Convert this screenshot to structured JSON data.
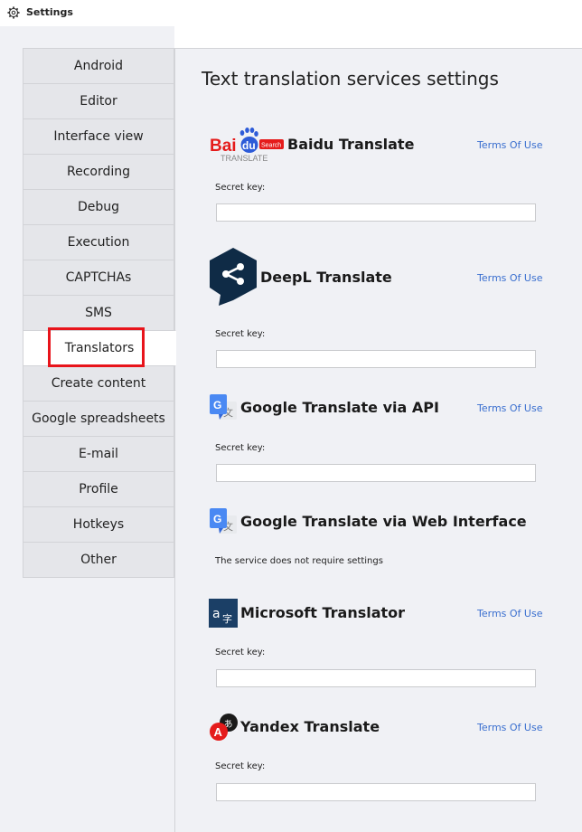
{
  "window": {
    "title": "Settings",
    "icon": "gear-icon"
  },
  "sidebar": {
    "items": [
      {
        "label": "Android"
      },
      {
        "label": "Editor"
      },
      {
        "label": "Interface view"
      },
      {
        "label": "Recording"
      },
      {
        "label": "Debug"
      },
      {
        "label": "Execution"
      },
      {
        "label": "CAPTCHAs"
      },
      {
        "label": "SMS"
      },
      {
        "label": "Translators",
        "active": true
      },
      {
        "label": "Create content"
      },
      {
        "label": "Google spreadsheets"
      },
      {
        "label": "E-mail"
      },
      {
        "label": "Profile"
      },
      {
        "label": "Hotkeys"
      },
      {
        "label": "Other"
      }
    ]
  },
  "main": {
    "title": "Text translation services settings",
    "services": {
      "baidu": {
        "name": "Baidu Translate",
        "terms": "Terms Of Use",
        "key_label": "Secret key:",
        "key_value": "",
        "logo": {
          "icon": "baidu-logo-icon",
          "text_bai": "Bai",
          "text_du": "du",
          "text_search": "Search",
          "text_translate": "TRANSLATE"
        }
      },
      "deepl": {
        "name": "DeepL Translate",
        "terms": "Terms Of Use",
        "key_label": "Secret key:",
        "key_value": "",
        "logo": {
          "icon": "deepl-logo-icon"
        }
      },
      "google_api": {
        "name": "Google Translate via API",
        "terms": "Terms Of Use",
        "key_label": "Secret key:",
        "key_value": "",
        "logo": {
          "icon": "google-translate-icon"
        }
      },
      "google_web": {
        "name": "Google Translate via Web Interface",
        "note": "The service does not require settings",
        "logo": {
          "icon": "google-translate-icon"
        }
      },
      "microsoft": {
        "name": "Microsoft Translator",
        "terms": "Terms Of Use",
        "key_label": "Secret key:",
        "key_value": "",
        "logo": {
          "icon": "microsoft-translator-icon"
        }
      },
      "yandex": {
        "name": "Yandex Translate",
        "terms": "Terms Of Use",
        "key_label": "Secret key:",
        "key_value": "",
        "logo": {
          "icon": "yandex-translate-icon"
        }
      }
    }
  },
  "colors": {
    "accent_link": "#3a6fcf",
    "highlight": "#e8141b",
    "panel_bg": "#f0f1f5",
    "nav_bg": "#e5e6ea"
  }
}
